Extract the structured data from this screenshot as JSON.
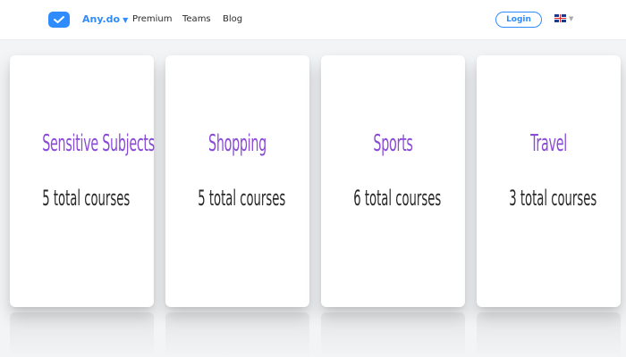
{
  "header": {
    "brand": "Any.do",
    "nav_links": [
      "Premium",
      "Teams",
      "Blog"
    ],
    "login_label": "Login",
    "language_icon": "uk-flag-icon"
  },
  "cards": [
    {
      "title": "Sensitive Subjects",
      "count": "5 total courses"
    },
    {
      "title": "Shopping",
      "count": "5 total courses"
    },
    {
      "title": "Sports",
      "count": "6 total courses"
    },
    {
      "title": "Travel",
      "count": "3 total courses"
    }
  ],
  "colors": {
    "accent": "#2f8cff",
    "title": "#8a4bd6",
    "text": "#2a2a2a",
    "background": "#f3f4f6"
  }
}
